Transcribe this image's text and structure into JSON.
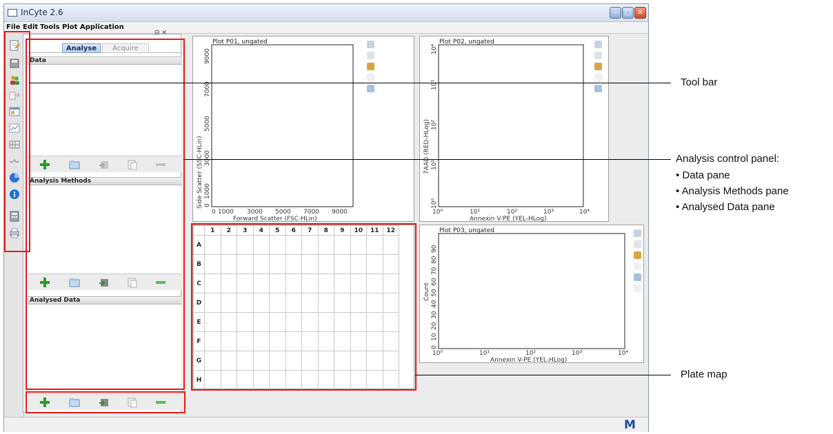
{
  "window": {
    "title": "InCyte 2.6"
  },
  "menu": {
    "items": [
      "File",
      "Edit",
      "Tools",
      "Plot",
      "Application"
    ]
  },
  "panel": {
    "tabs": {
      "analyse": "Analyse",
      "acquire": "Acquire"
    },
    "panes": {
      "data": "Data",
      "methods": "Analysis Methods",
      "analysed": "Analysed Data"
    }
  },
  "plots": {
    "p01": {
      "title": "Plot P01, ungated",
      "xlabel": "Forward Scatter (FSC-HLin)",
      "ylabel": "Side Scatter (SSC-HLin)",
      "xticks": [
        "0",
        "1000",
        "3000",
        "5000",
        "7000",
        "9000"
      ],
      "yticks": [
        "0",
        "1000",
        "3000",
        "5000",
        "7000",
        "9000"
      ]
    },
    "p02": {
      "title": "Plot P02, ungated",
      "xlabel": "Annexin V-PE (YEL-HLog)",
      "ylabel": "7AAD (RED-HLog)",
      "xticks": [
        "10⁰",
        "10¹",
        "10²",
        "10³",
        "10⁴"
      ],
      "yticks": [
        "10⁰",
        "10¹",
        "10²",
        "10³",
        "10⁴"
      ]
    },
    "p03": {
      "title": "Plot P03, ungated",
      "xlabel": "Annexin V-PE (YEL-HLog)",
      "ylabel": "Count",
      "xticks": [
        "10⁰",
        "10¹",
        "10²",
        "10³",
        "10⁴"
      ],
      "yticks": [
        "0",
        "10",
        "20",
        "30",
        "40",
        "50",
        "60",
        "70",
        "80",
        "90"
      ]
    }
  },
  "plate": {
    "columns": [
      "1",
      "2",
      "3",
      "4",
      "5",
      "6",
      "7",
      "8",
      "9",
      "10",
      "11",
      "12"
    ],
    "rows": [
      "A",
      "B",
      "C",
      "D",
      "E",
      "F",
      "G",
      "H"
    ]
  },
  "status": {
    "logo": "M"
  },
  "callouts": {
    "toolbar": "Tool bar",
    "panel_title": "Analysis control panel:",
    "panel_items": [
      "• Data pane",
      "• Analysis Methods pane",
      "• Analysed Data pane"
    ],
    "plate": "Plate map"
  },
  "colors": {
    "annotation": "#e21a1a",
    "add": "#2c9a2c",
    "remove": "#5fb85f"
  }
}
